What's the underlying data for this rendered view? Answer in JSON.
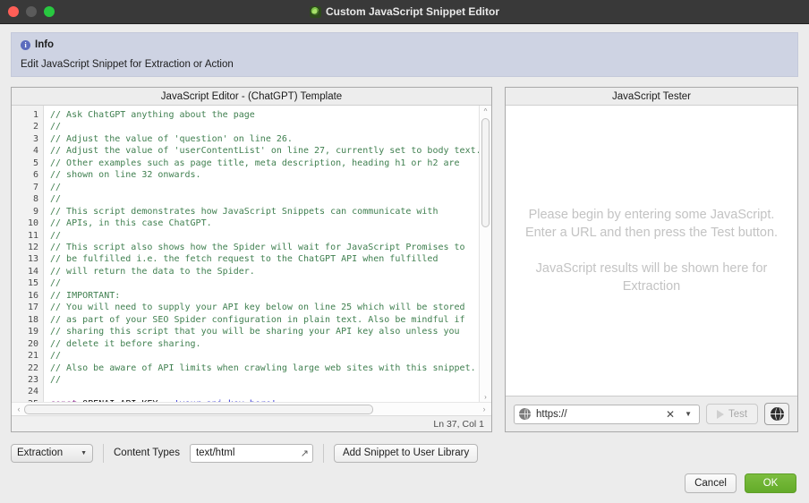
{
  "window": {
    "title": "Custom JavaScript Snippet Editor",
    "icon": "spider-icon"
  },
  "info": {
    "heading": "Info",
    "icon": "info-icon",
    "text": "Edit JavaScript Snippet for Extraction or Action"
  },
  "editor": {
    "title": "JavaScript Editor - (ChatGPT) Template",
    "status": "Ln 37, Col 1",
    "first_line": 1,
    "lines": [
      "// Ask ChatGPT anything about the page",
      "//",
      "// Adjust the value of 'question' on line 26.",
      "// Adjust the value of 'userContentList' on line 27, currently set to body text.",
      "// Other examples such as page title, meta description, heading h1 or h2 are",
      "// shown on line 32 onwards.",
      "//",
      "//",
      "// This script demonstrates how JavaScript Snippets can communicate with",
      "// APIs, in this case ChatGPT.",
      "//",
      "// This script also shows how the Spider will wait for JavaScript Promises to",
      "// be fulfilled i.e. the fetch request to the ChatGPT API when fulfilled",
      "// will return the data to the Spider.",
      "//",
      "// IMPORTANT:",
      "// You will need to supply your API key below on line 25 which will be stored",
      "// as part of your SEO Spider configuration in plain text. Also be mindful if",
      "// sharing this script that you will be sharing your API key also unless you",
      "// delete it before sharing.",
      "//",
      "// Also be aware of API limits when crawling large web sites with this snippet.",
      "//",
      "",
      "const OPENAI_API_KEY = 'your_api_key_here';",
      ""
    ],
    "code_line_25": {
      "keyword": "const",
      "identifier": "OPENAI_API_KEY",
      "operator": "=",
      "string": "'your_api_key_here'",
      "terminator": ";"
    },
    "colors": {
      "comment": "#3f7f4f",
      "keyword": "#8e2a8e",
      "string": "#2a2ad2",
      "identifier": "#111111"
    }
  },
  "tester": {
    "title": "JavaScript Tester",
    "message_1": "Please begin by entering some JavaScript. Enter a URL and then press the Test button.",
    "message_2": "JavaScript results will be shown here for Extraction",
    "url_value": "https://",
    "url_icon": "globe-icon",
    "clear_icon": "clear-x-icon",
    "dropdown_icon": "chevron-down-icon",
    "test_label": "Test",
    "test_icon": "play-icon",
    "browser_icon": "globe-icon"
  },
  "toolbar": {
    "mode_value": "Extraction",
    "mode_arrow": "chevron-down-icon",
    "content_types_label": "Content Types",
    "content_types_value": "text/html",
    "expand_icon": "expand-arrow-icon",
    "add_snippet_label": "Add Snippet to User Library"
  },
  "footer": {
    "cancel_label": "Cancel",
    "ok_label": "OK",
    "ok_color": "#6fb335"
  }
}
